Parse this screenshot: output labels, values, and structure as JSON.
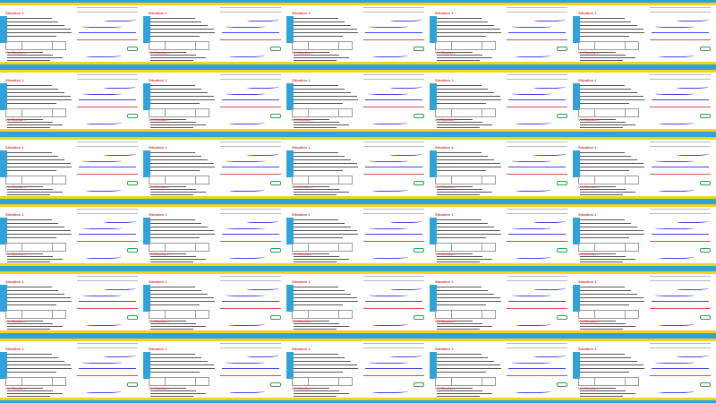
{
  "grid": {
    "columns": 10,
    "rows": 6,
    "section_heading": "Situation 1",
    "subheading": "Pour aller plus loin",
    "footer_heading": "Vérification :",
    "accent_blue": "#2fa3d9",
    "accent_yellow": "#f6d21b",
    "ink_color": "#4a3fe0",
    "red_color": "#e04a4a",
    "green_color": "#2e9e4e"
  }
}
